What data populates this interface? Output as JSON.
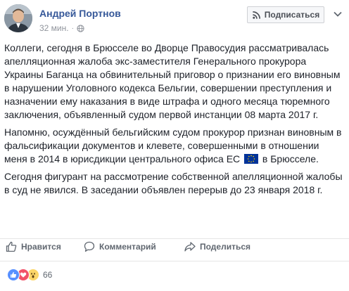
{
  "post": {
    "author_name": "Андрей Портнов",
    "timestamp": "32 мин.",
    "privacy_icon": "globe-icon",
    "follow_button_label": "Подписаться",
    "paragraphs": [
      "Коллеги, сегодня в Брюсселе во Дворце Правосудия рассматривалась апелляционная жалоба экс-заместителя Генерального прокурора Украины Баганца на обвинительный приговор о признании его виновным в нарушении Уголовного кодекса Бельгии, совершении преступления и назначении ему наказания в виде штрафа и одного месяца тюремного заключения, объявленный судом первой инстанции 08 марта 2017 г.",
      "Сегодня фигурант на рассмотрение собственной апелляционной жалобы в суд не явился. В заседании объявлен перерыв до 23 января 2018 г."
    ],
    "paragraph2_before_flag": "Напомню, осуждённый бельгийским судом прокурор признан виновным в фальсификации документов и клевете, совершенными в отношении меня в 2014 в юрисдикции центрального офиса ЕС",
    "paragraph2_after_flag": "в Брюсселе."
  },
  "actions": {
    "like_label": "Нравится",
    "comment_label": "Комментарий",
    "share_label": "Поделиться"
  },
  "reactions": {
    "icons": [
      "like-icon",
      "love-icon",
      "wow-icon"
    ],
    "count": "66"
  },
  "colors": {
    "link": "#365899",
    "text": "#1d2129",
    "meta": "#90949c",
    "like_blue": "#5890ff",
    "love_red": "#f25268",
    "wow_yellow": "#fcd669",
    "eu_blue": "#003399",
    "eu_yellow": "#ffcc00"
  }
}
